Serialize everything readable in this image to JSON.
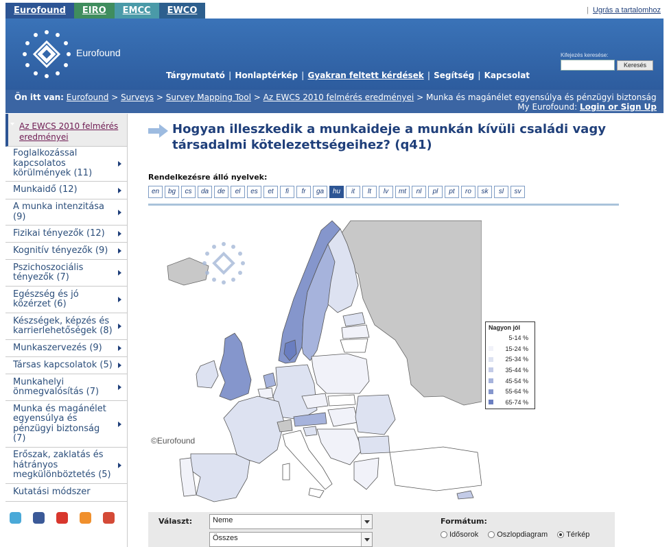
{
  "tabs": [
    {
      "label": "Eurofound",
      "name": "tab-eurofound"
    },
    {
      "label": "EIRO",
      "name": "tab-eiro"
    },
    {
      "label": "EMCC",
      "name": "tab-emcc"
    },
    {
      "label": "EWCO",
      "name": "tab-ewco"
    }
  ],
  "skip_link": "Ugrás a tartalomhoz",
  "header": {
    "logo_text": "Eurofound",
    "nav": [
      "Tárgymutató",
      "Honlaptérkép",
      "Gyakran feltett kérdések",
      "Segítség",
      "Kapcsolat"
    ],
    "search_label": "Kifejezés keresése:",
    "search_value": "",
    "search_button": "Keresés"
  },
  "breadcrumb": {
    "prefix": "Ön itt van:",
    "links": [
      "Eurofound",
      "Surveys",
      "Survey Mapping Tool",
      "Az EWCS 2010 felmérés eredményei"
    ],
    "current": "Munka és magánélet egyensúlya és pénzügyi biztonság",
    "my_eurofound": "My Eurofound:",
    "login": "Login or Sign Up"
  },
  "sidebar": {
    "active": "Az EWCS 2010 felmérés eredményei",
    "items": [
      "Foglalkozással kapcsolatos körülmények (11)",
      "Munkaidő (12)",
      "A munka intenzitása (9)",
      "Fizikai tényezők (12)",
      "Kognitív tényezők (9)",
      "Pszichoszociális tényezők (7)",
      "Egészség és jó közérzet (6)",
      "Készségek, képzés és karrierlehetőségek (8)",
      "Munkaszervezés (9)",
      "Társas kapcsolatok (5)",
      "Munkahelyi önmegvalósítás (7)",
      "Munka és magánélet egyensúlya és pénzügyi biztonság (7)",
      "Erőszak, zaklatás és hátrányos megkülönböztetés (5)",
      "Kutatási módszer"
    ],
    "social_icons": [
      "twitter-icon",
      "facebook-icon",
      "youtube-icon",
      "rss-icon",
      "google-plus-icon"
    ]
  },
  "main": {
    "title": "Hogyan illeszkedik a munkaideje a munkán kívüli családi vagy társadalmi kötelezettségeihez? (q41)",
    "languages_label": "Rendelkezésre álló nyelvek:",
    "languages": [
      "en",
      "bg",
      "cs",
      "da",
      "de",
      "el",
      "es",
      "et",
      "fi",
      "fr",
      "ga",
      "hu",
      "it",
      "lt",
      "lv",
      "mt",
      "nl",
      "pl",
      "pt",
      "ro",
      "sk",
      "sl",
      "sv"
    ],
    "active_language": "hu",
    "copyright": "©Eurofound"
  },
  "legend": {
    "title": "Nagyon jól",
    "classes": [
      {
        "label": "5-14 %",
        "color": "#ffffff"
      },
      {
        "label": "15-24 %",
        "color": "#f1f2f9"
      },
      {
        "label": "25-34 %",
        "color": "#dde2f1"
      },
      {
        "label": "35-44 %",
        "color": "#c3cbe7"
      },
      {
        "label": "45-54 %",
        "color": "#a6b3dc"
      },
      {
        "label": "55-64 %",
        "color": "#8596cc"
      },
      {
        "label": "65-74 %",
        "color": "#6a7ec0"
      }
    ]
  },
  "controls": {
    "select_label": "Választ:",
    "select1_value": "Neme",
    "select2_value": "Összes",
    "format_label": "Formátum:",
    "formats": [
      "Idősorok",
      "Oszlopdiagram",
      "Térkép"
    ],
    "selected_format": "Térkép"
  },
  "colors": {
    "nav_blue": "#2d5594",
    "header_blue": "#3a73b8",
    "no_data_grey": "#c8c8c8"
  }
}
